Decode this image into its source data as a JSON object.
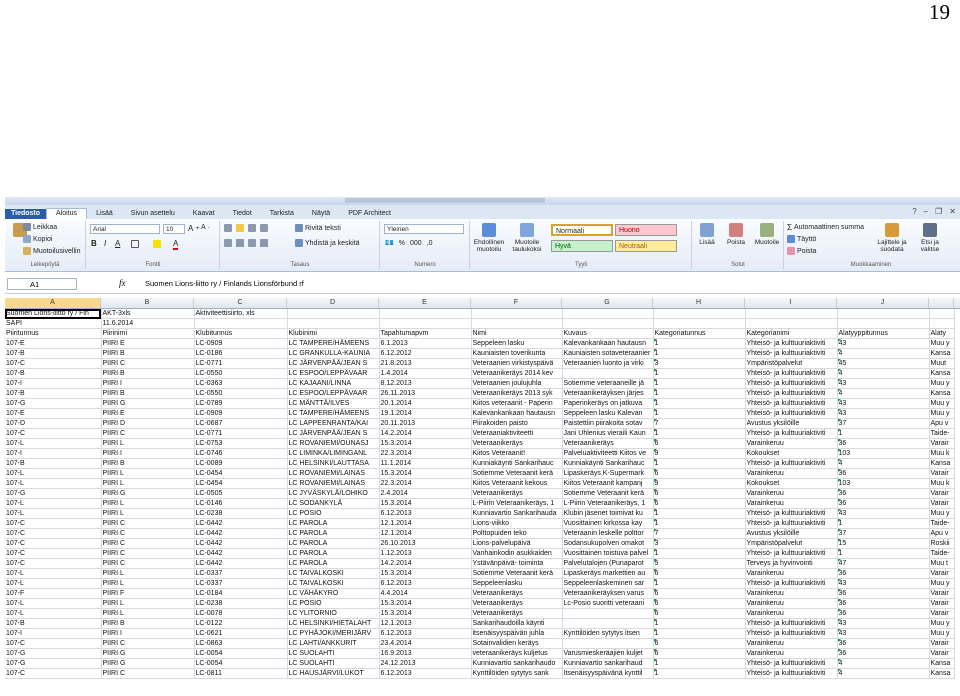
{
  "page_number": "19",
  "tabs": [
    "Tiedosto",
    "Aloitus",
    "Lisää",
    "Sivun asettelu",
    "Kaavat",
    "Tiedot",
    "Tarkista",
    "Näytä",
    "PDF Architect"
  ],
  "ribbon": {
    "clipboard": {
      "cut": "Leikkaa",
      "copy": "Kopioi",
      "format_painter": "Muotoilusivellin",
      "label": "Leikepöytä"
    },
    "font": {
      "name": "Arial",
      "size": "10",
      "label": "Fontti"
    },
    "alignment": {
      "wrap": "Rivitä teksti",
      "merge": "Yhdistä ja keskitä",
      "label": "Tasaus"
    },
    "number": {
      "format": "Yleinen",
      "label": "Numero"
    },
    "styles": {
      "cond": "Ehdollinen muotoilu",
      "table": "Muotoile taulukoksi",
      "normal": "Normaali",
      "bad": "Huono",
      "good": "Hyvä",
      "neutral": "Neutraali",
      "label": "Tyyli"
    },
    "cells": {
      "insert": "Lisää",
      "delete": "Poista",
      "format": "Muotoile",
      "label": "Solut"
    },
    "editing": {
      "autosum": "Automaattinen summa",
      "fill": "Täyttö",
      "clear": "Poista",
      "sort": "Lajittele ja suodata",
      "find": "Etsi ja valitse",
      "label": "Muokkaaminen"
    }
  },
  "formula_bar": {
    "name_box": "A1",
    "fx": "fx",
    "formula": "Suomen Lions-liitto ry / Finlands Lionsförbund rf"
  },
  "columns": [
    "A",
    "B",
    "C",
    "D",
    "E",
    "F",
    "G",
    "H",
    "I",
    "J",
    ""
  ],
  "rows": [
    [
      "Suomen Lions-liitto ry / Fin",
      "AKT-3xls",
      "Aktiviteettisiirto, xls",
      "",
      "",
      "",
      "",
      "",
      "",
      "",
      ""
    ],
    [
      "SAPI",
      "11.6.2014",
      "",
      "",
      "",
      "",
      "",
      "",
      "",
      "",
      ""
    ],
    [
      "Piiritunnus",
      "Piirinimi",
      "Klubitunnus",
      "Klubinimi",
      "Tapahtumapvm",
      "Nimi",
      "Kuvaus",
      "Kategoriatunnus",
      "Kategorianimi",
      "Alatyyppitunnus",
      "Alaty"
    ],
    [
      "107-E",
      "PIIRI E",
      "LC-0909",
      "LC TAMPERE/HÄMEENS",
      "6.1.2013",
      "Seppeleen lasku",
      "Kalevankankaan hautausn",
      "1",
      "Yhteisö- ja kulttuuriaktiviti",
      "43",
      "Muu y"
    ],
    [
      "107-B",
      "PIIRI B",
      "LC-0186",
      "LC GRANKULLA-KAUNIA",
      "6.12.2012",
      "Kauniaisten toverikunta",
      "Kauniaisten sotaveteraanier",
      "1",
      "Yhteisö- ja kulttuuriaktiviti",
      "4",
      "Kansa"
    ],
    [
      "107-C",
      "PIIRI C",
      "LC-0771",
      "LC JÄRVENPÄÄ/JEAN S",
      "21.8.2013",
      "Veteraanien virkistyspäivä",
      "Veteraanien luonto ja virki",
      "3",
      "Ympäristöpalvelut",
      "45",
      "Muut"
    ],
    [
      "107-B",
      "PIIRI B",
      "LC-0550",
      "LC ESPOO/LEPPÄVAAR",
      "1.4.2014",
      "Veteraanikeräys 2014 kev",
      "",
      "1",
      "Yhteisö- ja kulttuuriaktiviti",
      "4",
      "Kansa"
    ],
    [
      "107-I",
      "PIIRI I",
      "LC-0363",
      "LC KAJAANI/LINNA",
      "8.12.2013",
      "Veteraanien joulujuhla",
      "Sotiemme veteraaneille jä",
      "1",
      "Yhteisö- ja kulttuuriaktiviti",
      "43",
      "Muu y"
    ],
    [
      "107-B",
      "PIIRI B",
      "LC-0550",
      "LC ESPOO/LEPPÄVAAR",
      "26.11.2013",
      "Veteraanikeräys 2013 syk",
      "Veteraanikeräyksen järjes",
      "1",
      "Yhteisö- ja kulttuuriaktiviti",
      "4",
      "Kansa"
    ],
    [
      "107-G",
      "PIIRI G",
      "LC-0789",
      "LC MÄNTTÄ/ILVES",
      "20.1.2014",
      "Kiitos veteraanit - Paperin",
      "Paperinkeräys on jatkuva",
      "1",
      "Yhteisö- ja kulttuuriaktiviti",
      "43",
      "Muu y"
    ],
    [
      "107-E",
      "PIIRI E",
      "LC-0909",
      "LC TAMPERE/HÄMEENS",
      "19.1.2014",
      "Kalevankankaan hautausn",
      "Seppeleen lasku Kalevan",
      "1",
      "Yhteisö- ja kulttuuriaktiviti",
      "43",
      "Muu y"
    ],
    [
      "107-D",
      "PIIRI D",
      "LC-0687",
      "LC LAPPEENRANTA/KAI",
      "20.11.2013",
      "Piirakoiden paisto",
      "Paistettiin piirakoita sotav",
      "7",
      "Avustus yksilöille",
      "37",
      "Apu v"
    ],
    [
      "107-C",
      "PIIRI C",
      "LC-0771",
      "LC JÄRVENPÄÄ/JEAN S",
      "14.2.2014",
      "Veteraaniaktiviteetti",
      "Jani Uhlenius vieraili Kaun",
      "1",
      "Yhteisö- ja kulttuuriaktiviti",
      "1",
      "Taide-"
    ],
    [
      "107-L",
      "PIIRI L",
      "LC-0753",
      "LC ROVANIEMI/OUNASJ",
      "15.3.2014",
      "Veteraanikeräys",
      "Veteraanikeräys",
      "6",
      "Varainkeruu",
      "36",
      "Varair"
    ],
    [
      "107-I",
      "PIIRI I",
      "LC-0746",
      "LC LIMINKA/LIMINGANL",
      "22.3.2014",
      "Kiitos Veteraanit!",
      "Palveluaktiviteetti Kiitos ve",
      "9",
      "Kokoukset",
      "103",
      "Muu k"
    ],
    [
      "107-B",
      "PIIRI B",
      "LC-0089",
      "LC HELSINKI/LAUTTASA",
      "11.1.2014",
      "Kunniakäynti Sankarihauc",
      "Kunniakäynti Sankarihauc",
      "1",
      "Yhteisö- ja kulttuuriaktiviti",
      "4",
      "Kansa"
    ],
    [
      "107-L",
      "PIIRI L",
      "LC-0454",
      "LC ROVANIEMI/LAINAS",
      "15.3.2014",
      "Sotiemme Veteraanit kerä",
      "Lipaskeräys K-Supermark",
      "6",
      "Varainkeruu",
      "36",
      "Varair"
    ],
    [
      "107-L",
      "PIIRI L",
      "LC-0454",
      "LC ROVANIEMI/LAINAS",
      "22.3.2014",
      "Kiitos Veteraanit kekous",
      "Kiitos Veteraanit kampanj",
      "9",
      "Kokoukset",
      "103",
      "Muu k"
    ],
    [
      "107-G",
      "PIIRI G",
      "LC-0505",
      "LC JYVÄSKYLÄ/LÖHIKO",
      "2.4.2014",
      "Veteraanikeräys",
      "Sotiemme Veteraanit kerä",
      "6",
      "Varainkeruu",
      "36",
      "Varair"
    ],
    [
      "107-L",
      "PIIRI L",
      "LC-0146",
      "LC SODANKYLÄ",
      "15.3.2014",
      "L-Piirin Veteraanikeräys, 1",
      "L-Piirin Veteraanikeräys, 1",
      "6",
      "Varainkeruu",
      "36",
      "Varair"
    ],
    [
      "107-L",
      "PIIRI L",
      "LC-0238",
      "LC POSIO",
      "6.12.2013",
      "Kunniavartio Sankarihauda",
      "Klubin jäsenet toimivat ku",
      "1",
      "Yhteisö- ja kulttuuriaktiviti",
      "43",
      "Muu y"
    ],
    [
      "107-C",
      "PIIRI C",
      "LC-0442",
      "LC PAROLA",
      "12.1.2014",
      "Lions-viikko",
      "Vuosittainen kirkossa kay",
      "1",
      "Yhteisö- ja kulttuuriaktiviti",
      "1",
      "Taide-"
    ],
    [
      "107-C",
      "PIIRI C",
      "LC-0442",
      "LC PAROLA",
      "12.1.2014",
      "Polttopuiden teko",
      "Veteraanin leskelle polttor",
      "7",
      "Avustus yksilöille",
      "37",
      "Apu v"
    ],
    [
      "107-C",
      "PIIRI C",
      "LC-0442",
      "LC PAROLA",
      "26.10.2013",
      "Lions-palvelupäivä",
      "Sodansukupolven omakot",
      "3",
      "Ympäristöpalvelut",
      "15",
      "Roskii"
    ],
    [
      "107-C",
      "PIIRI C",
      "LC-0442",
      "LC PAROLA",
      "1.12.2013",
      "Vanhainkodin asukkaiden",
      "Vuosittainen toistuva palvel",
      "1",
      "Yhteisö- ja kulttuuriaktiviti",
      "1",
      "Taide-"
    ],
    [
      "107-C",
      "PIIRI C",
      "LC-0442",
      "LC PAROLA",
      "14.2.2014",
      "Ystävänpäivä- toiminta",
      "Palvelutalojen (Punaparot",
      "5",
      "Terveys ja hyvinvointi",
      "47",
      "Muu t"
    ],
    [
      "107-L",
      "PIIRI L",
      "LC-0337",
      "LC TAIVALKOSKI",
      "15.3.2014",
      "Sotiemme Veteraanit kerä",
      "Lipaskeräys markettien au",
      "6",
      "Varainkeruu",
      "36",
      "Varair"
    ],
    [
      "107-L",
      "PIIRI L",
      "LC-0337",
      "LC TAIVALKOSKI",
      "6.12.2013",
      "Seppeleenlasku",
      "Seppeleenlaskeminen sar",
      "1",
      "Yhteisö- ja kulttuuriaktiviti",
      "43",
      "Muu y"
    ],
    [
      "107-F",
      "PIIRI F",
      "LC-0184",
      "LC VÄHÄKYRÖ",
      "4.4.2014",
      "Veteraanikeräys",
      "Veteraanikeräyksen varus",
      "6",
      "Varainkeruu",
      "36",
      "Varair"
    ],
    [
      "107-L",
      "PIIRI L",
      "LC-0238",
      "LC POSIO",
      "15.3.2014",
      "Veteraanikeräys",
      "Lc-Posio suoritti veteraani",
      "6",
      "Varainkeruu",
      "36",
      "Varair"
    ],
    [
      "107-L",
      "PIIRI L",
      "LC-0078",
      "LC YLITORNIO",
      "15.3.2014",
      "Veteraanikeräys",
      "",
      "6",
      "Varainkeruu",
      "36",
      "Varair"
    ],
    [
      "107-B",
      "PIIRI B",
      "LC-0122",
      "LC HELSINKI/HIETALAHT",
      "12.1.2013",
      "Sankarihaudoilla käynti",
      "",
      "1",
      "Yhteisö- ja kulttuuriaktiviti",
      "43",
      "Muu y"
    ],
    [
      "107-I",
      "PIIRI I",
      "LC-0621",
      "LC PYHÄJOKI/MERIJÄRV",
      "6.12.2013",
      "itsenäisyyspäivän juhla",
      "Kynttilöiden sytytys itsen",
      "1",
      "Yhteisö- ja kulttuuriaktiviti",
      "43",
      "Muu y"
    ],
    [
      "107-C",
      "PIIRI C",
      "LC-0863",
      "LC LAHTI/ANKKURIT",
      "23.4.2014",
      "Sotainvalidien keräys",
      "",
      "6",
      "Varainkeruu",
      "36",
      "Varair"
    ],
    [
      "107-G",
      "PIIRI G",
      "LC-0054",
      "LC SUOLAHTI",
      "16.9.2013",
      "veteraanikeräys kuljetus",
      "Varusmieskeräajien kuljet",
      "6",
      "Varainkeruu",
      "36",
      "Varair"
    ],
    [
      "107-G",
      "PIIRI G",
      "LC-0054",
      "LC SUOLAHTI",
      "24.12.2013",
      "Kunniavartio sankarihaudo",
      "Kunniavartio sankarihaud",
      "1",
      "Yhteisö- ja kulttuuriaktiviti",
      "4",
      "Kansa"
    ],
    [
      "107-C",
      "PIIRI C",
      "LC-0811",
      "LC HAUSJÄRVI/LUKOT",
      "6.12.2013",
      "Kynttilöiden sytytys sank",
      "Itsenäisyyspäivänä kynttil",
      "1",
      "Yhteisö- ja kulttuuriaktiviti",
      "4",
      "Kansa"
    ]
  ],
  "colors": {
    "file_tab": "#2a5caa",
    "good": "#c6efce",
    "bad": "#ffc7ce",
    "neutral": "#ffeb9c",
    "selected_header": "#f8d88d"
  }
}
